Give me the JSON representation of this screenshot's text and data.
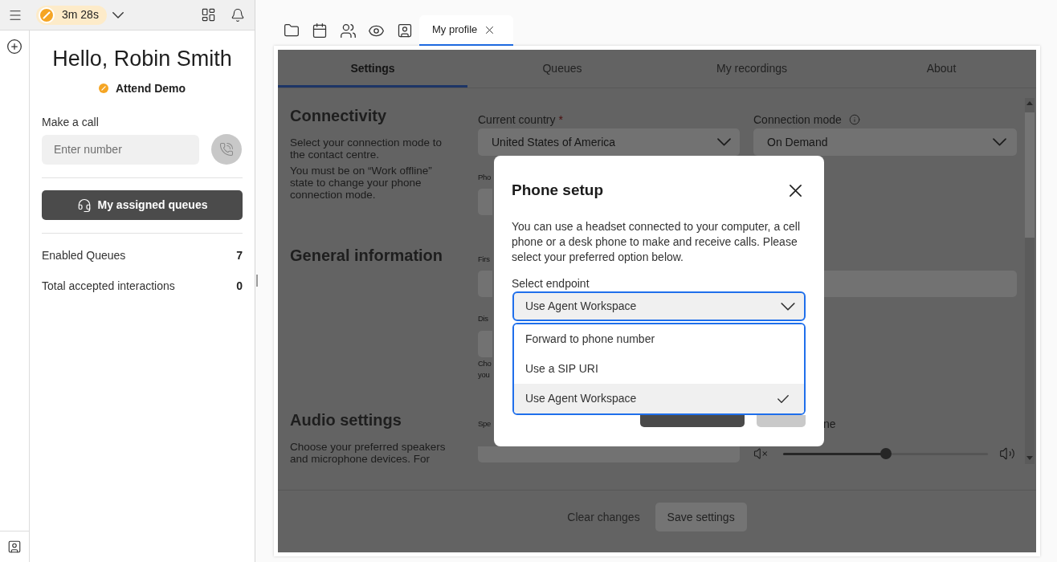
{
  "top_bar": {
    "timer": "3m 28s"
  },
  "greeting": "Hello, Robin Smith",
  "status": {
    "label": "Attend Demo"
  },
  "make_call": {
    "label": "Make a call",
    "placeholder": "Enter number"
  },
  "queues_button": "My assigned queues",
  "stats": [
    {
      "label": "Enabled Queues",
      "value": "7"
    },
    {
      "label": "Total accepted interactions",
      "value": "0"
    }
  ],
  "open_tabs": [
    {
      "label": "My profile",
      "selected": true
    }
  ],
  "settings": {
    "tabs": [
      {
        "label": "Settings",
        "selected": true
      },
      {
        "label": "Queues",
        "selected": false
      },
      {
        "label": "My recordings",
        "selected": false
      },
      {
        "label": "About",
        "selected": false
      }
    ]
  },
  "connectivity": {
    "title": "Connectivity",
    "description": [
      "Select your connection mode to the contact centre.",
      "You must be on “Work offline” state to change your phone connection mode."
    ],
    "country": {
      "label": "Current country",
      "required_mark": "*",
      "value": "United States of America"
    },
    "connection_mode": {
      "label": "Connection mode",
      "value": "On Demand"
    },
    "phone_label": "Pho"
  },
  "general_information": {
    "title": "General information",
    "first_name_label": "Firs",
    "display_name_label": "Dis",
    "hint_lines": [
      "Cho",
      "you"
    ]
  },
  "audio_settings": {
    "title": "Audio settings",
    "description": "Choose your preferred speakers and microphone devices. For",
    "speaker_label": "Spe",
    "volume_label": "ne",
    "volume": {
      "level": 0.5
    }
  },
  "footer": {
    "buttons": [
      {
        "label": "Clear changes",
        "kind": "link"
      },
      {
        "label": "Save settings",
        "kind": "button"
      }
    ]
  },
  "dialog": {
    "title": "Phone setup",
    "body": "You can use a headset connected to your computer, a cell phone or a desk phone to make and receive calls. Please select your preferred option below.",
    "endpoint": {
      "label": "Select endpoint",
      "value": "Use Agent Workspace",
      "expanded": true,
      "options": [
        {
          "label": "Forward to phone number",
          "selected": false
        },
        {
          "label": "Use a SIP URI",
          "selected": false
        },
        {
          "label": "Use Agent Workspace",
          "selected": true
        }
      ]
    }
  }
}
